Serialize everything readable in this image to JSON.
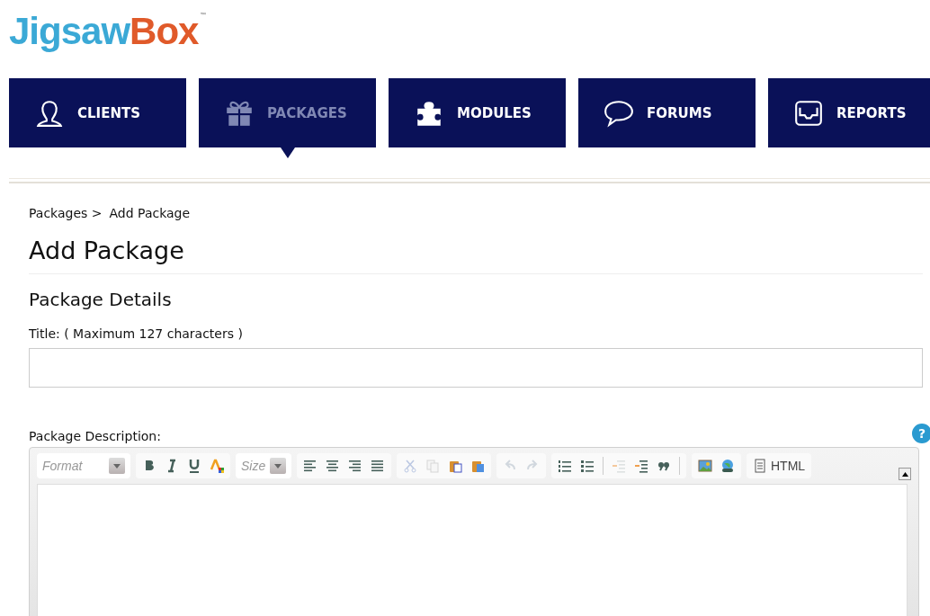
{
  "logo": {
    "first": "Jigsaw",
    "second": "Box",
    "mark": "™"
  },
  "nav": [
    {
      "label": "CLIENTS",
      "kind": "person",
      "selected": false
    },
    {
      "label": "PACKAGES",
      "kind": "gift",
      "selected": true
    },
    {
      "label": "MODULES",
      "kind": "puzzle",
      "selected": false
    },
    {
      "label": "FORUMS",
      "kind": "speech",
      "selected": false
    },
    {
      "label": "REPORTS",
      "kind": "tray",
      "selected": false
    }
  ],
  "breadcrumb": [
    {
      "label": "Packages >"
    },
    {
      "label": "Add Package"
    }
  ],
  "title": "Add Package",
  "section": "Package Details",
  "title_field": {
    "label": "Title: ( Maximum 127 characters )"
  },
  "description": {
    "label": "Package Description:",
    "help": "?"
  },
  "editor": {
    "format": {
      "placeholder": "Format"
    },
    "size": {
      "placeholder": "Size"
    },
    "groups": [
      [
        {
          "kind": "bold",
          "disabled": false
        },
        {
          "kind": "italic",
          "disabled": false
        },
        {
          "kind": "underline",
          "disabled": false
        },
        {
          "kind": "textcolor",
          "disabled": false
        }
      ],
      [
        {
          "kind": "size"
        }
      ],
      [
        {
          "kind": "alignleft",
          "disabled": false
        },
        {
          "kind": "aligncenter",
          "disabled": false
        },
        {
          "kind": "alignright",
          "disabled": false
        },
        {
          "kind": "justify",
          "disabled": false
        }
      ],
      [
        {
          "kind": "cut",
          "disabled": true
        },
        {
          "kind": "copy",
          "disabled": true
        },
        {
          "kind": "paste",
          "disabled": false
        },
        {
          "kind": "pasteword",
          "disabled": false
        }
      ],
      [
        {
          "kind": "undo",
          "disabled": true
        },
        {
          "kind": "redo",
          "disabled": true
        }
      ],
      [
        {
          "kind": "numlist",
          "disabled": false
        },
        {
          "kind": "bullist",
          "disabled": false
        },
        {
          "kind": "sep"
        },
        {
          "kind": "outdent",
          "disabled": true
        },
        {
          "kind": "indent",
          "disabled": false
        },
        {
          "kind": "quote",
          "disabled": false
        },
        {
          "kind": "sep"
        }
      ],
      [
        {
          "kind": "image",
          "disabled": false
        },
        {
          "kind": "link",
          "disabled": false
        }
      ],
      [
        {
          "kind": "html",
          "label": "HTML",
          "disabled": false
        }
      ]
    ]
  }
}
